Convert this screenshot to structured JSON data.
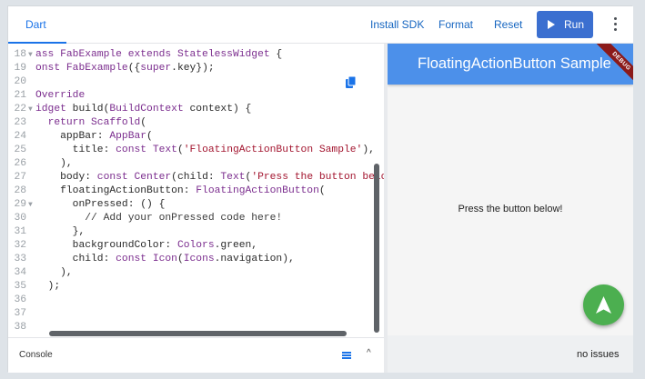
{
  "toolbar": {
    "tab_label": "Dart",
    "install_sdk": "Install SDK",
    "format": "Format",
    "reset": "Reset",
    "run": "Run",
    "accent": "#3b6fd0"
  },
  "editor": {
    "lines": [
      {
        "n": "18",
        "fold": "▼",
        "segs": [
          [
            "kw",
            "ass "
          ],
          [
            "cls",
            "FabExample"
          ],
          [
            "kw",
            " extends "
          ],
          [
            "cls",
            "StatelessWidget"
          ],
          [
            "",
            " {"
          ]
        ]
      },
      {
        "n": "19",
        "fold": "",
        "segs": [
          [
            "kw",
            "onst "
          ],
          [
            "cls",
            "FabExample"
          ],
          [
            "",
            "({"
          ],
          [
            "kw",
            "super"
          ],
          [
            "",
            ".key});"
          ]
        ]
      },
      {
        "n": "20",
        "fold": "",
        "segs": []
      },
      {
        "n": "21",
        "fold": "",
        "segs": [
          [
            "meta",
            "Override"
          ]
        ]
      },
      {
        "n": "22",
        "fold": "▼",
        "segs": [
          [
            "cls",
            "idget"
          ],
          [
            "",
            " build("
          ],
          [
            "cls",
            "BuildContext"
          ],
          [
            "",
            " context) {"
          ]
        ]
      },
      {
        "n": "23",
        "fold": "",
        "segs": [
          [
            "",
            "  "
          ],
          [
            "kw",
            "return "
          ],
          [
            "cls",
            "Scaffold"
          ],
          [
            "",
            "("
          ]
        ]
      },
      {
        "n": "24",
        "fold": "",
        "segs": [
          [
            "",
            "    appBar: "
          ],
          [
            "cls",
            "AppBar"
          ],
          [
            "",
            "("
          ]
        ]
      },
      {
        "n": "25",
        "fold": "",
        "segs": [
          [
            "",
            "      title: "
          ],
          [
            "kw",
            "const "
          ],
          [
            "cls",
            "Text"
          ],
          [
            "",
            "("
          ],
          [
            "str",
            "'FloatingActionButton Sample'"
          ],
          [
            "",
            "),"
          ]
        ]
      },
      {
        "n": "26",
        "fold": "",
        "segs": [
          [
            "",
            "    ),"
          ]
        ]
      },
      {
        "n": "27",
        "fold": "",
        "segs": [
          [
            "",
            "    body: "
          ],
          [
            "kw",
            "const "
          ],
          [
            "cls",
            "Center"
          ],
          [
            "",
            "(child: "
          ],
          [
            "cls",
            "Text"
          ],
          [
            "",
            "("
          ],
          [
            "str",
            "'Press the button belo"
          ]
        ]
      },
      {
        "n": "28",
        "fold": "",
        "segs": [
          [
            "",
            "    floatingActionButton: "
          ],
          [
            "cls",
            "FloatingActionButton"
          ],
          [
            "",
            "("
          ]
        ]
      },
      {
        "n": "29",
        "fold": "▼",
        "segs": [
          [
            "",
            "      onPressed: () {"
          ]
        ]
      },
      {
        "n": "30",
        "fold": "",
        "segs": [
          [
            "cmt",
            "        // Add your onPressed code here!"
          ]
        ]
      },
      {
        "n": "31",
        "fold": "",
        "segs": [
          [
            "",
            "      },"
          ]
        ]
      },
      {
        "n": "32",
        "fold": "",
        "segs": [
          [
            "",
            "      backgroundColor: "
          ],
          [
            "cls",
            "Colors"
          ],
          [
            "",
            ".green,"
          ]
        ]
      },
      {
        "n": "33",
        "fold": "",
        "segs": [
          [
            "",
            "      child: "
          ],
          [
            "kw",
            "const "
          ],
          [
            "cls",
            "Icon"
          ],
          [
            "",
            "("
          ],
          [
            "cls",
            "Icons"
          ],
          [
            "",
            ".navigation),"
          ]
        ]
      },
      {
        "n": "34",
        "fold": "",
        "segs": [
          [
            "",
            "    ),"
          ]
        ]
      },
      {
        "n": "35",
        "fold": "",
        "segs": [
          [
            "",
            "  );"
          ]
        ]
      },
      {
        "n": "36",
        "fold": "",
        "segs": [
          [
            "",
            ""
          ]
        ]
      },
      {
        "n": "37",
        "fold": "",
        "segs": []
      },
      {
        "n": "38",
        "fold": "",
        "segs": []
      }
    ]
  },
  "console": {
    "label": "Console",
    "icons": [
      "list-icon",
      "chevron-up-icon"
    ]
  },
  "preview": {
    "appbar_title": "FloatingActionButton Sample",
    "debug_label": "DEBUG",
    "body_text": "Press the button below!",
    "appbar_color": "#4c90ea",
    "fab_color": "#4caf50",
    "fab_icon": "navigation-icon"
  },
  "status": {
    "issues": "no issues"
  }
}
